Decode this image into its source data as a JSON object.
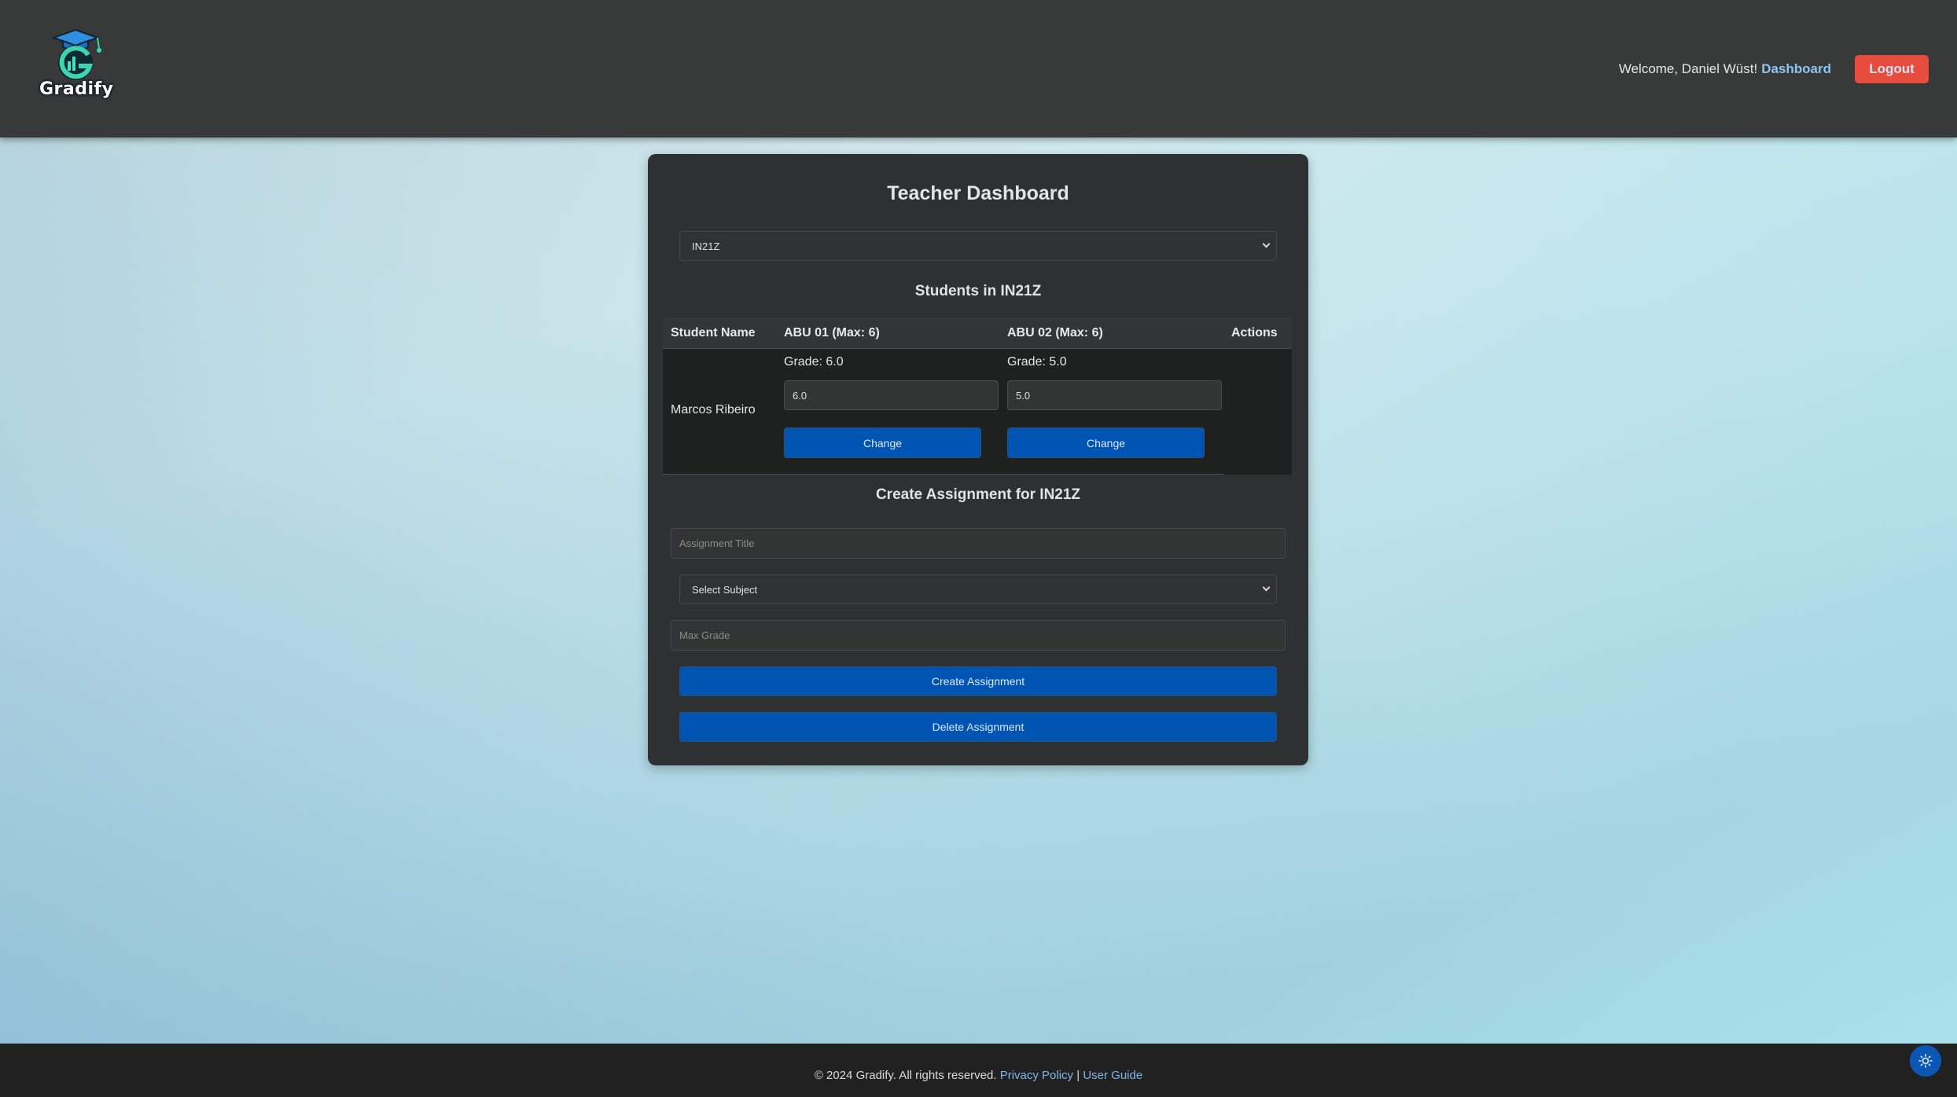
{
  "header": {
    "logo_text": "Gradify",
    "welcome_text": "Welcome, Daniel Wüst!",
    "dashboard_link": "Dashboard",
    "logout_label": "Logout"
  },
  "card": {
    "title": "Teacher Dashboard",
    "class_select_value": "IN21Z",
    "students_title": "Students in IN21Z",
    "table": {
      "columns": [
        "Student Name",
        "ABU 01 (Max: 6)",
        "ABU 02 (Max: 6)",
        "Actions"
      ],
      "rows": [
        {
          "student_name": "Marcos Ribeiro",
          "grades": [
            {
              "label": "Grade: 6.0",
              "input_value": "6.0",
              "button_label": "Change"
            },
            {
              "label": "Grade: 5.0",
              "input_value": "5.0",
              "button_label": "Change"
            }
          ]
        }
      ]
    },
    "create_title": "Create Assignment for IN21Z",
    "assignment_title_placeholder": "Assignment Title",
    "subject_select_value": "Select Subject",
    "max_grade_placeholder": "Max Grade",
    "create_button": "Create Assignment",
    "delete_button": "Delete Assignment"
  },
  "footer": {
    "copyright": "© 2024 Gradify. All rights reserved.",
    "privacy_link": "Privacy Policy",
    "separator": "|",
    "guide_link": "User Guide"
  },
  "theme_toggle": {
    "icon": "sun-icon"
  },
  "colors": {
    "header_bg": "#383a3a",
    "card_bg": "#2e3132",
    "primary_button": "#0055b3",
    "logout_button": "#e74c3c",
    "link": "#8cc4f0",
    "footer_bg": "#212121"
  }
}
